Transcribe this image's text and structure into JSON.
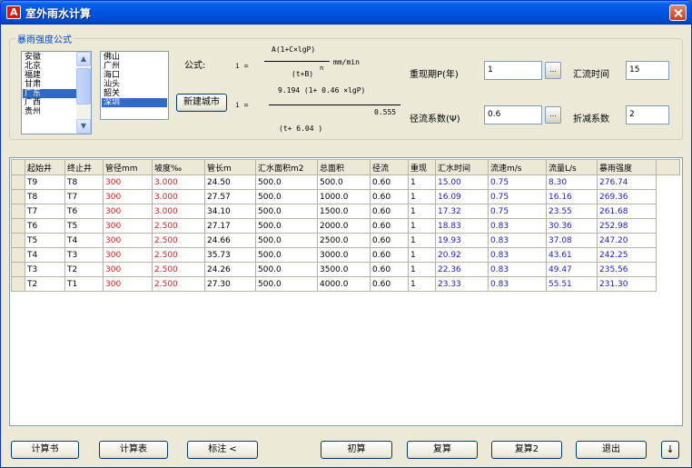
{
  "window": {
    "title": "室外雨水计算"
  },
  "group": {
    "title": "暴雨强度公式"
  },
  "provinces": [
    "安徽",
    "北京",
    "福建",
    "甘肃",
    "广东",
    "广西",
    "贵州"
  ],
  "province_selected_index": 4,
  "cities": [
    "佛山",
    "广州",
    "海口",
    "汕头",
    "韶关",
    "深圳"
  ],
  "city_selected_index": 5,
  "formula": {
    "label": "公式:",
    "row1_lhs": "i =",
    "row1_num": "A(1+C×lgP)",
    "row1_den": "(t+B)",
    "row1_exp": "n",
    "row1_unit": "mm/min",
    "row2_lhs": "i =",
    "row2_num": "9.194  (1+  0.46  ×lgP)",
    "row2_exp": "0.555",
    "row2_den": "(t+  6.04         )"
  },
  "new_city_button": "新建城市",
  "params": {
    "period_label": "重现期P(年)",
    "period_value": "1",
    "time_label": "汇流时间",
    "time_value": "15",
    "runoff_label": "径流系数(Ψ)",
    "runoff_value": "0.6",
    "reduction_label": "折减系数",
    "reduction_value": "2",
    "browse_label": "..."
  },
  "table": {
    "columns": [
      "起始井",
      "终止井",
      "管径mm",
      "坡度‰",
      "管长m",
      "汇水面积m2",
      "总面积",
      "径流",
      "重现",
      "汇水时间",
      "流速m/s",
      "流量L/s",
      "暴雨强度"
    ],
    "rows": [
      [
        "T9",
        "T8",
        "300",
        "3.000",
        "24.50",
        "500.0",
        "500.0",
        "0.60",
        "1",
        "15.00",
        "0.75",
        "8.30",
        "276.74"
      ],
      [
        "T8",
        "T7",
        "300",
        "3.000",
        "27.57",
        "500.0",
        "1000.0",
        "0.60",
        "1",
        "16.09",
        "0.75",
        "16.16",
        "269.36"
      ],
      [
        "T7",
        "T6",
        "300",
        "3.000",
        "34.10",
        "500.0",
        "1500.0",
        "0.60",
        "1",
        "17.32",
        "0.75",
        "23.55",
        "261.68"
      ],
      [
        "T6",
        "T5",
        "300",
        "2.500",
        "27.17",
        "500.0",
        "2000.0",
        "0.60",
        "1",
        "18.83",
        "0.83",
        "30.36",
        "252.98"
      ],
      [
        "T5",
        "T4",
        "300",
        "2.500",
        "24.66",
        "500.0",
        "2500.0",
        "0.60",
        "1",
        "19.93",
        "0.83",
        "37.08",
        "247.20"
      ],
      [
        "T4",
        "T3",
        "300",
        "2.500",
        "35.73",
        "500.0",
        "3000.0",
        "0.60",
        "1",
        "20.92",
        "0.83",
        "43.61",
        "242.25"
      ],
      [
        "T3",
        "T2",
        "300",
        "2.500",
        "24.26",
        "500.0",
        "3500.0",
        "0.60",
        "1",
        "22.36",
        "0.83",
        "49.47",
        "235.56"
      ],
      [
        "T2",
        "T1",
        "300",
        "2.500",
        "27.30",
        "500.0",
        "4000.0",
        "0.60",
        "1",
        "23.33",
        "0.83",
        "55.51",
        "231.30"
      ]
    ]
  },
  "buttons": {
    "calc_book": "计算书",
    "calc_table": "计算表",
    "annotate": "标注 <",
    "initial": "初算",
    "recalc": "复算",
    "recalc2": "复算2",
    "exit": "退出",
    "down": "↓"
  },
  "colors": {
    "red_columns": "#e02020",
    "blue_columns": "#1e20d8",
    "selection": "#316ac5",
    "titlebar": "#0054e3"
  }
}
